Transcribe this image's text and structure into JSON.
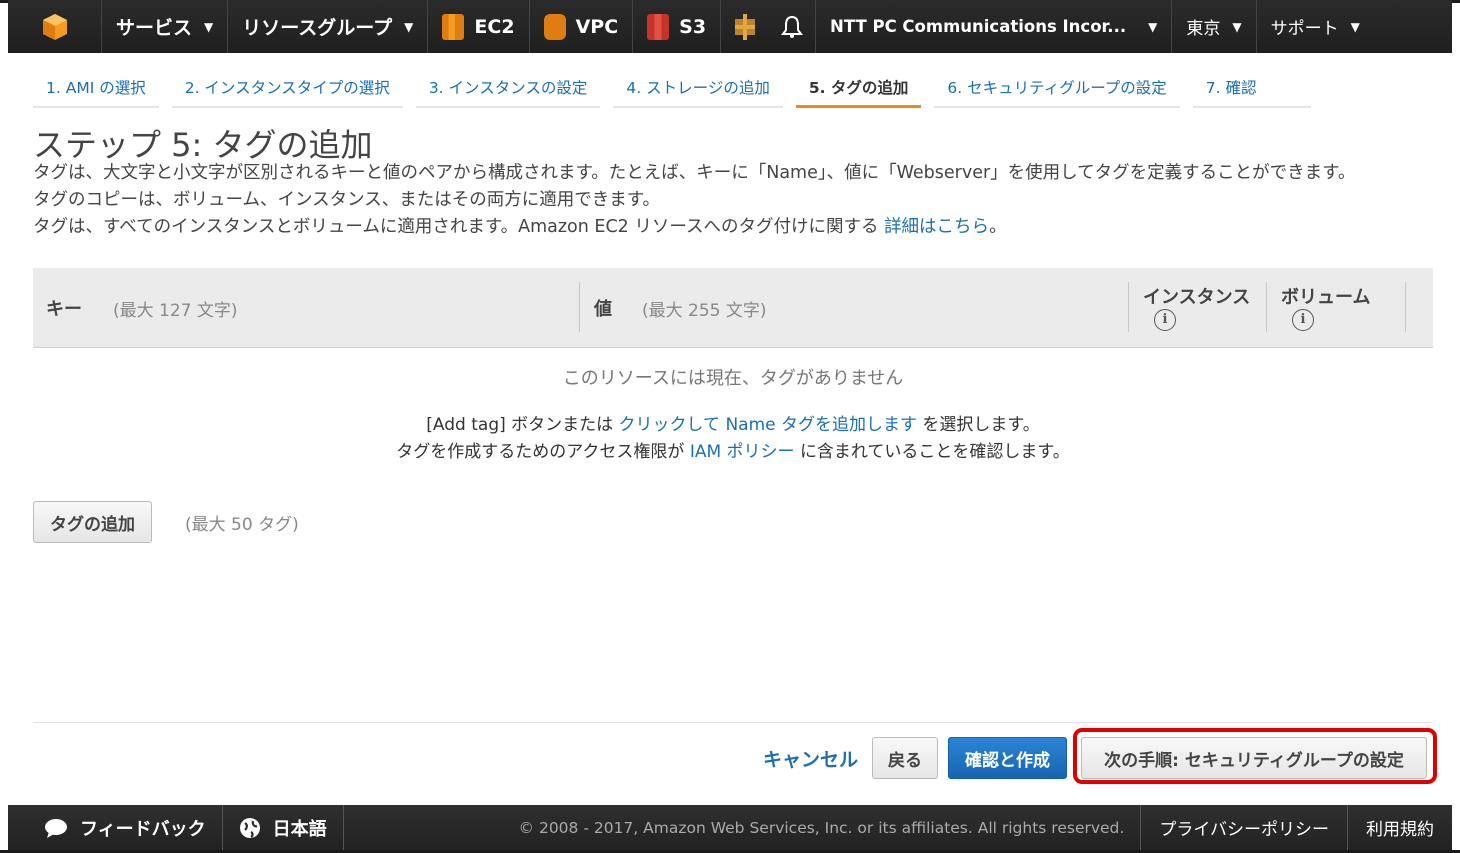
{
  "nav": {
    "services": "サービス",
    "resource_groups": "リソースグループ",
    "shortcuts": [
      "EC2",
      "VPC",
      "S3"
    ],
    "account": "NTT PC Communications Incor...",
    "region": "東京",
    "support": "サポート"
  },
  "steps": [
    {
      "label": "1. AMI の選択",
      "active": false
    },
    {
      "label": "2. インスタンスタイプの選択",
      "active": false
    },
    {
      "label": "3. インスタンスの設定",
      "active": false
    },
    {
      "label": "4. ストレージの追加",
      "active": false
    },
    {
      "label": "5. タグの追加",
      "active": true
    },
    {
      "label": "6. セキュリティグループの設定",
      "active": false
    },
    {
      "label": "7. 確認",
      "active": false
    }
  ],
  "page": {
    "title": "ステップ 5: タグの追加",
    "desc_line1": "タグは、大文字と小文字が区別されるキーと値のペアから構成されます。たとえば、キーに「Name」、値に「Webserver」を使用してタグを定義することができます。",
    "desc_line2": "タグのコピーは、ボリューム、インスタンス、またはその両方に適用できます。",
    "desc_line3_prefix": "タグは、すべてのインスタンスとボリュームに適用されます。Amazon EC2 リソースへのタグ付けに関する",
    "desc_line3_link": "詳細はこちら",
    "desc_line3_suffix": "。"
  },
  "table": {
    "key_header": "キー",
    "key_hint": "(最大 127 文字)",
    "value_header": "値",
    "value_hint": "(最大 255 文字)",
    "instance_header": "インスタンス",
    "volume_header": "ボリューム",
    "info_glyph": "i",
    "empty_message": "このリソースには現在、タグがありません"
  },
  "help": {
    "line1_prefix": "[Add tag] ボタンまたは",
    "line1_link": "クリックして Name タグを追加します",
    "line1_suffix": "を選択します。",
    "line2_prefix": "タグを作成するためのアクセス権限が",
    "line2_link": "IAM ポリシー",
    "line2_suffix": "に含まれていることを確認します。"
  },
  "actions": {
    "add_tag": "タグの追加",
    "add_tag_hint": "(最大 50 タグ)",
    "cancel": "キャンセル",
    "back": "戻る",
    "review_launch": "確認と作成",
    "next": "次の手順: セキュリティグループの設定"
  },
  "footer": {
    "feedback": "フィードバック",
    "language": "日本語",
    "copyright": "© 2008 - 2017, Amazon Web Services, Inc. or its affiliates. All rights reserved.",
    "privacy": "プライバシーポリシー",
    "terms": "利用規約"
  },
  "colors": {
    "accent_orange": "#e88b1f",
    "link_blue": "#1a6fb5",
    "primary_button": "#1f74c4",
    "highlight_red": "#e00000",
    "nav_bg": "#232323"
  },
  "icons": {
    "logo": "aws-cube-icon",
    "ec2": "ec2-icon",
    "vpc": "vpc-icon",
    "s3": "s3-icon",
    "pin": "pin-service-icon",
    "bell": "bell-icon",
    "feedback": "speech-bubble-icon",
    "language": "globe-icon"
  }
}
